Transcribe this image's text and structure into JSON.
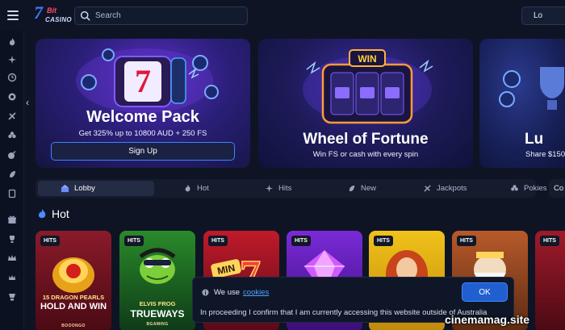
{
  "header": {
    "logo_text": "7Bit CASINO",
    "search_placeholder": "Search",
    "login_label": "Lo"
  },
  "sidebar": {
    "icons": [
      "flame-icon",
      "sparkle-icon",
      "clock-icon",
      "gift-icon",
      "cherries-icon",
      "clover-icon",
      "rocket-icon",
      "card-icon",
      "gift-box-icon",
      "trophy-icon",
      "crown-icon",
      "crown-small-icon",
      "cup-icon"
    ]
  },
  "banners": [
    {
      "title": "Welcome Pack",
      "subtitle": "Get 325% up to 10800 AUD + 250 FS",
      "button": "Sign Up"
    },
    {
      "title": "Wheel of Fortune",
      "subtitle": "Win FS or cash with every spin",
      "badge": "WIN"
    },
    {
      "title": "Lu",
      "subtitle": "Share $150"
    }
  ],
  "tabs": [
    {
      "label": "Lobby",
      "icon": "lobby-icon"
    },
    {
      "label": "Hot",
      "icon": "flame-icon"
    },
    {
      "label": "Hits",
      "icon": "sparkle-icon"
    },
    {
      "label": "New",
      "icon": "rocket-icon"
    },
    {
      "label": "Jackpots",
      "icon": "jackpot-icon"
    },
    {
      "label": "Pokies",
      "icon": "cherries-icon"
    }
  ],
  "tab_extra": "Co",
  "section": {
    "title": "Hot"
  },
  "games": [
    {
      "badge": "HITS",
      "title_small": "15 DRAGON PEARLS",
      "title": "HOLD AND WIN",
      "provider": "BOOONGO"
    },
    {
      "badge": "HITS",
      "title_small": "ELVIS FROG",
      "title": "TRUEWAYS",
      "provider": "BGAMING"
    },
    {
      "badge": "HITS",
      "title": "MIN"
    },
    {
      "badge": "HITS"
    },
    {
      "badge": "HITS"
    },
    {
      "badge": "HITS"
    },
    {
      "badge": "HITS"
    }
  ],
  "cookie": {
    "lead": "We use",
    "link": "cookies",
    "text": "In proceeding I confirm that I am currently accessing this website outside of Australia",
    "ok_label": "OK"
  },
  "watermark": "cinemamag.site"
}
